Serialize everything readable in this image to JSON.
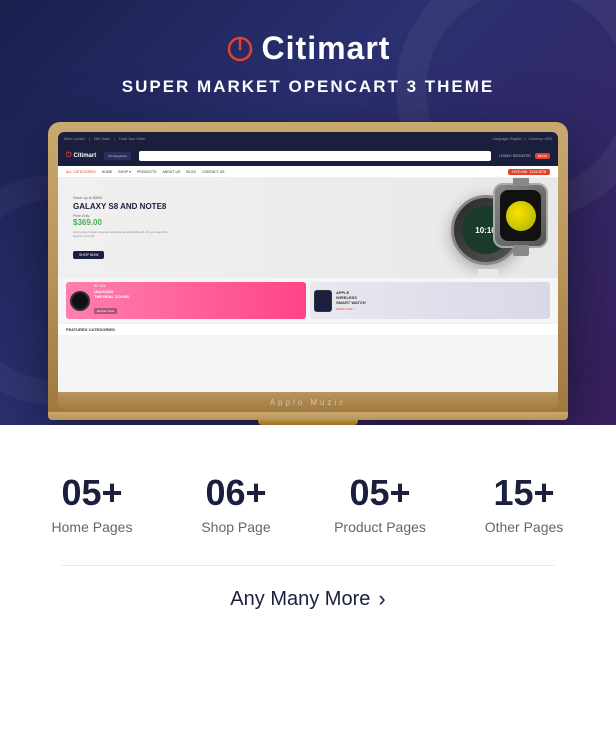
{
  "brand": {
    "name": "Citimart",
    "tagline": "SUPER MARKET OPENCART 3 THEME"
  },
  "laptop": {
    "brand_label": "Applo Muzic"
  },
  "mini_site": {
    "product_title": "GALAXY S8 AND NOTE8",
    "save_text": "Save up to $300",
    "price_label": "Price Only:",
    "price": "$369.00",
    "description": "Lorem ipsum dolor sit amet consectetur adipiscing elit. Do you want the best for your life.",
    "cta_button": "SHOP NOW",
    "banner1_label": "BF-104",
    "banner1_title": "UNLEASH\nTHE REAL SOUND",
    "banner1_cta": "Explore Now",
    "banner2_title": "APPLE\nWIRELESS\nSMART WATCH",
    "featured_label": "FEATURED CATEGORIES",
    "nav_items": [
      "ALL CATEGORIES",
      "HOME",
      "SHOP",
      "PRODUCTS",
      "ABOUT US",
      "BLOG",
      "CONTACT US"
    ],
    "cart_price": "$35.00",
    "login_text": "LOGIN / REGISTER"
  },
  "stats": [
    {
      "number": "05+",
      "label": "Home Pages"
    },
    {
      "number": "06+",
      "label": "Shop Page"
    },
    {
      "number": "05+",
      "label": "Product Pages"
    },
    {
      "number": "15+",
      "label": "Other Pages"
    }
  ],
  "more_link": {
    "text": "Any Many More",
    "arrow": "›"
  }
}
